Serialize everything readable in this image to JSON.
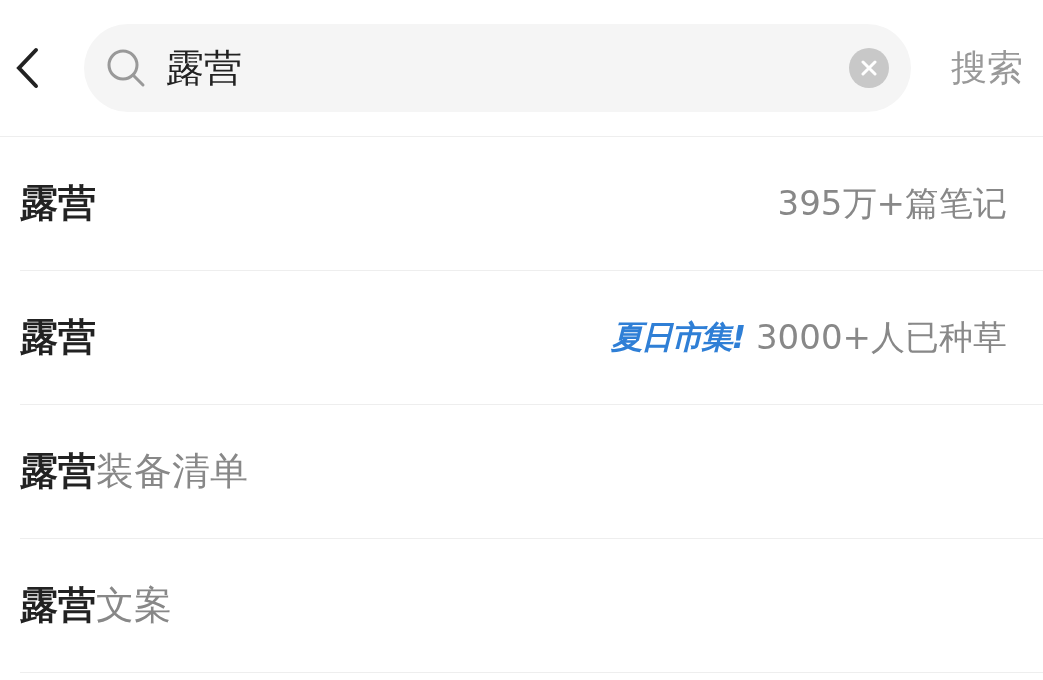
{
  "search": {
    "value": "露营",
    "action": "搜索"
  },
  "suggestions": [
    {
      "match": "露营",
      "meta": "395万+篇笔记"
    },
    {
      "match": "露营",
      "badge": "夏日市集!",
      "meta": "3000+人已种草"
    },
    {
      "match": "露营",
      "suffix": "装备清单"
    },
    {
      "match": "露营",
      "suffix": "文案"
    }
  ]
}
